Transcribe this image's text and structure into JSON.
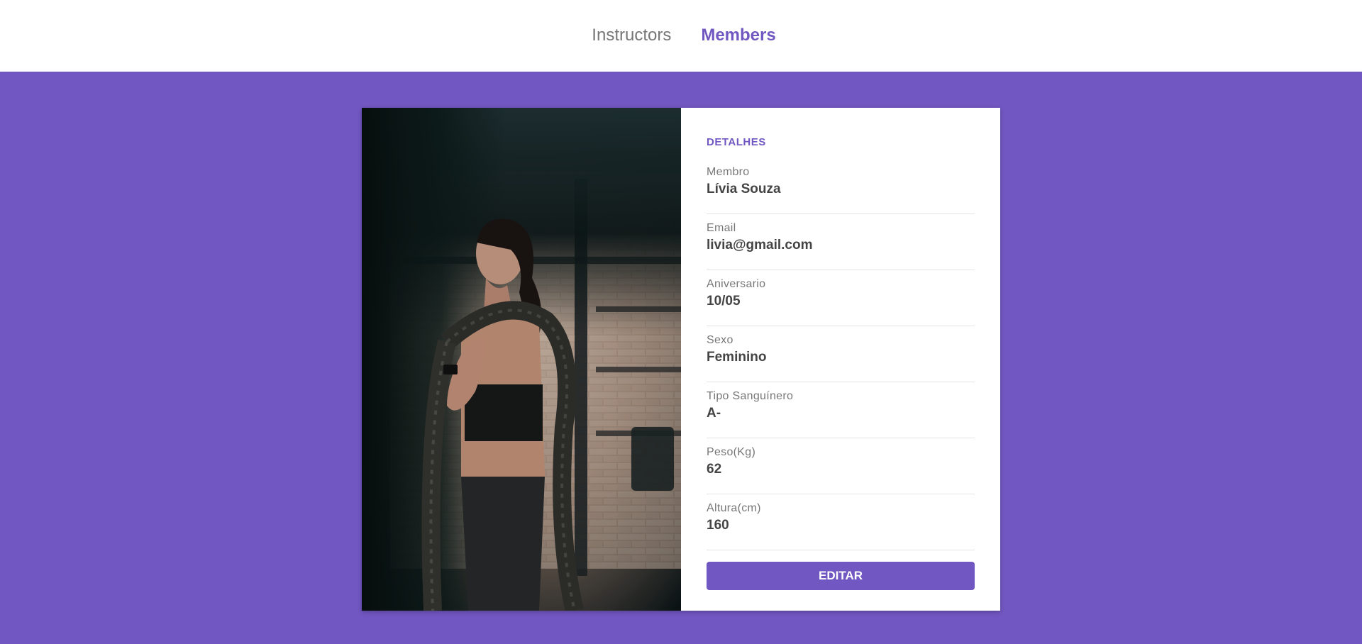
{
  "nav": {
    "items": [
      {
        "label": "Instructors",
        "active": false
      },
      {
        "label": "Members",
        "active": true
      }
    ]
  },
  "colors": {
    "brand": "#7157c1",
    "label": "#777777",
    "value": "#444444",
    "divider": "#e4e4e4"
  },
  "photo": {
    "description_icon": "member-photo"
  },
  "details": {
    "title": "DETALHES",
    "fields": [
      {
        "label": "Membro",
        "value": "Lívia Souza"
      },
      {
        "label": "Email",
        "value": "livia@gmail.com"
      },
      {
        "label": "Aniversario",
        "value": "10/05"
      },
      {
        "label": "Sexo",
        "value": "Feminino"
      },
      {
        "label": "Tipo Sanguínero",
        "value": "A-"
      },
      {
        "label": "Peso(Kg)",
        "value": "62"
      },
      {
        "label": "Altura(cm)",
        "value": "160"
      }
    ],
    "edit_label": "EDITAR"
  }
}
